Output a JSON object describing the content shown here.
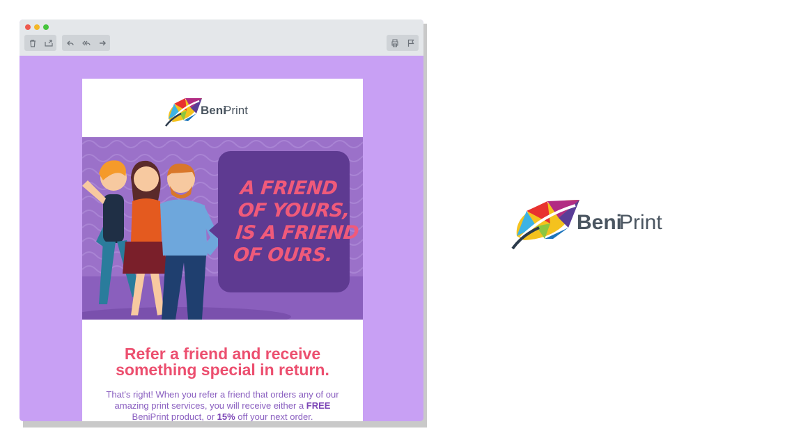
{
  "brand": {
    "name_bold": "Beni",
    "name_light": "Print"
  },
  "toolbar": {
    "delete_icon": "trash-icon",
    "move_icon": "folder-move-icon",
    "reply_icon": "reply-icon",
    "reply_all_icon": "reply-all-icon",
    "forward_icon": "forward-icon",
    "print_icon": "printer-icon",
    "flag_icon": "flag-icon"
  },
  "hero": {
    "bubble_lines": [
      "A FRIEND",
      "OF YOURS,",
      "IS A FRIEND",
      "OF OURS."
    ]
  },
  "email": {
    "headline_line1": "Refer a friend and receive",
    "headline_line2": "something special in return.",
    "body_part1": "That's right! When you refer a friend that orders any of our amazing print services, you will receive either a ",
    "body_free": "FREE",
    "body_part2": " BeniPrint product, or ",
    "body_percent": "15%",
    "body_part3": " off your next order."
  },
  "colors": {
    "window_bg": "#c8a0f4",
    "hero_bg": "#9b71c9",
    "bubble": "#5e3a91",
    "headline": "#ec4f6f",
    "body_text": "#8a5fc0",
    "brand_text": "#4a5560"
  }
}
